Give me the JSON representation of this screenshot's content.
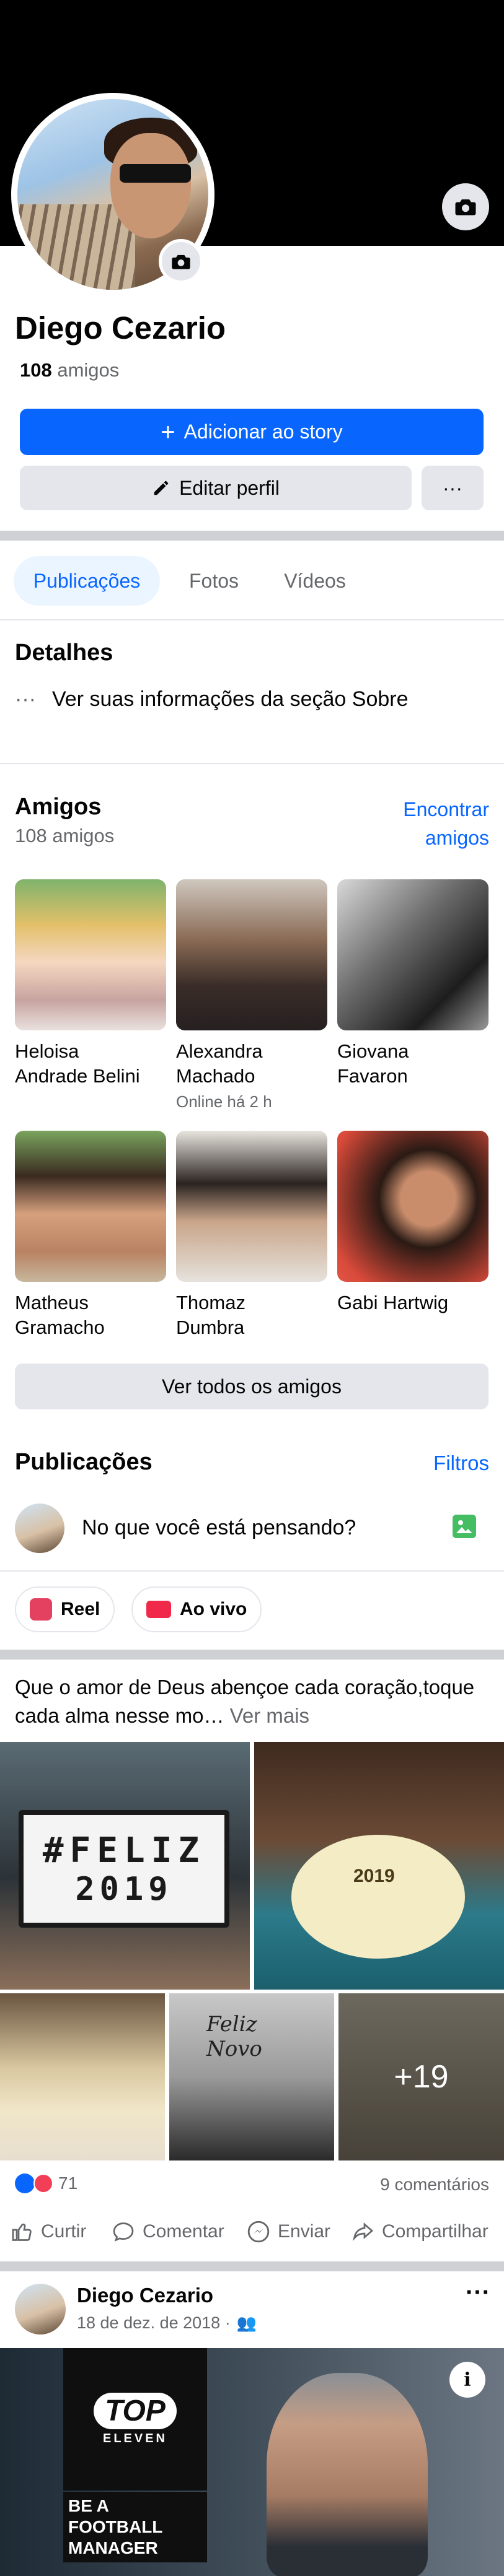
{
  "profile": {
    "name": "Diego Cezario",
    "friends_count": "108",
    "friends_label": "amigos",
    "add_story": "Adicionar ao story",
    "edit_profile": "Editar perfil",
    "more": "···"
  },
  "tabs": [
    "Publicações",
    "Fotos",
    "Vídeos"
  ],
  "details": {
    "title": "Detalhes",
    "about": "Ver suas informações da seção Sobre"
  },
  "friends": {
    "title": "Amigos",
    "count": "108 amigos",
    "find_line1": "Encontrar",
    "find_line2": "amigos",
    "list": [
      {
        "line1": "Heloisa",
        "line2": "Andrade Belini",
        "sub": ""
      },
      {
        "line1": "Alexandra",
        "line2": "Machado",
        "sub": "Online há 2 h"
      },
      {
        "line1": "Giovana",
        "line2": "Favaron",
        "sub": ""
      },
      {
        "line1": "Matheus",
        "line2": "Gramacho",
        "sub": ""
      },
      {
        "line1": "Thomaz",
        "line2": "Dumbra",
        "sub": ""
      },
      {
        "line1": "Gabi Hartwig",
        "line2": "",
        "sub": ""
      }
    ],
    "see_all": "Ver todos os amigos"
  },
  "posts": {
    "title": "Publicações",
    "filters": "Filtros",
    "composer_placeholder": "No que você está pensando?",
    "reel": "Reel",
    "live": "Ao vivo"
  },
  "post": {
    "text": "Que o amor de Deus abençoe cada coração,toque cada alma nesse mo…",
    "see_more": "Ver mais",
    "lightbox_line1": "#FELIZ",
    "lightbox_line2": "2019",
    "cake_text": "2019",
    "sign_line1": "Feliz",
    "sign_line2": "Novo",
    "more_photos": "+19",
    "reactions": "71",
    "comments": "9 comentários",
    "like": "Curtir",
    "comment": "Comentar",
    "send": "Enviar",
    "share": "Compartilhar"
  },
  "post2": {
    "author": "Diego Cezario",
    "date": "18 de dez. de 2018 ·",
    "more": "···"
  },
  "ad": {
    "brand_line1": "TOP",
    "brand_line2": "ELEVEN",
    "tagline1": "BE A FOOTBALL",
    "tagline2": "MANAGER",
    "info": "i"
  },
  "colors": {
    "accent": "#0866ff",
    "muted": "#65676b",
    "separator": "#ced0d4"
  }
}
